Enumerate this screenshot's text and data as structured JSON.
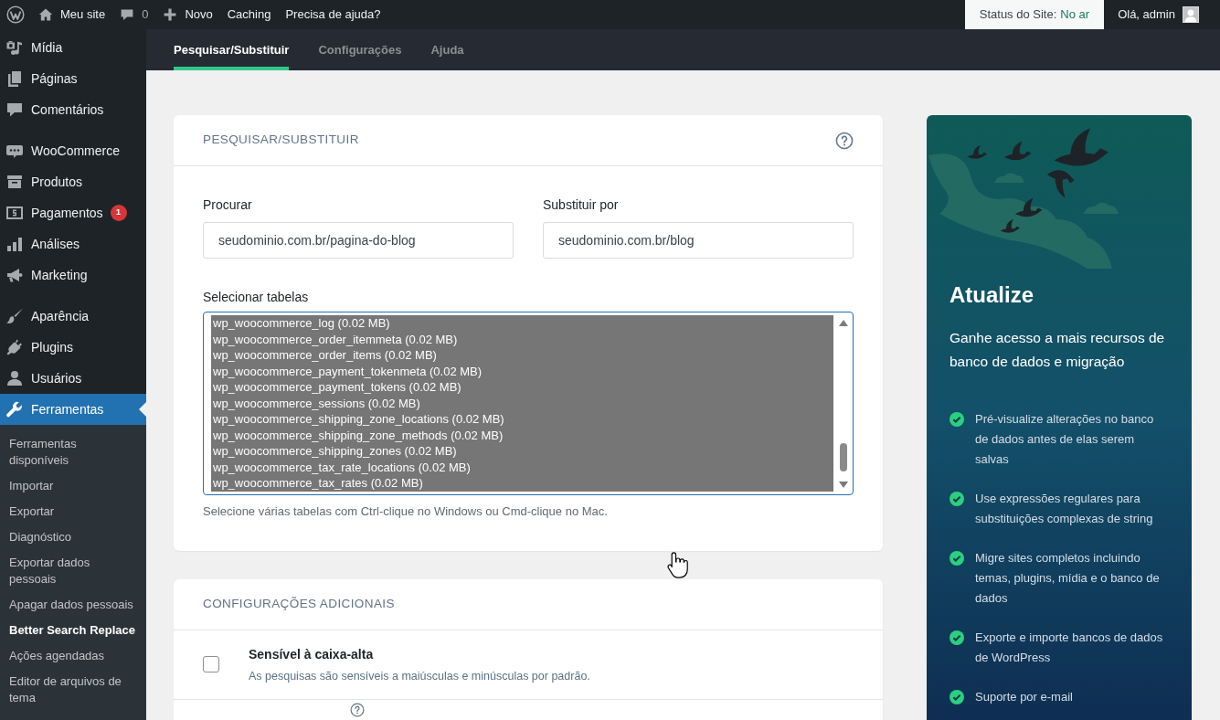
{
  "admin_bar": {
    "items": [
      {
        "kind": "home",
        "label": "Meu site"
      },
      {
        "kind": "comments",
        "label": "0"
      },
      {
        "kind": "new",
        "label": "Novo"
      },
      {
        "kind": "link",
        "label": "Caching"
      },
      {
        "kind": "link",
        "label": "Precisa de ajuda?"
      }
    ],
    "site_status": {
      "label": "Status do Site:",
      "value": "No ar"
    },
    "account": "Olá, admin"
  },
  "sidebar": {
    "groups": [
      {
        "items": [
          {
            "label": "Mídia",
            "selected": false
          },
          {
            "label": "Páginas",
            "selected": false
          },
          {
            "label": "Comentários",
            "selected": false
          }
        ]
      },
      {
        "items": [
          {
            "label": "WooCommerce",
            "selected": false
          },
          {
            "label": "Produtos",
            "selected": false
          },
          {
            "label": "Pagamentos",
            "selected": false,
            "badge": "1"
          },
          {
            "label": "Análises",
            "selected": false
          },
          {
            "label": "Marketing",
            "selected": false
          }
        ]
      },
      {
        "items": [
          {
            "label": "Aparência",
            "selected": false
          },
          {
            "label": "Plugins",
            "selected": false
          },
          {
            "label": "Usuários",
            "selected": false
          },
          {
            "label": "Ferramentas",
            "selected": true,
            "children": [
              {
                "label": "Ferramentas disponíveis",
                "selected": false
              },
              {
                "label": "Importar",
                "selected": false
              },
              {
                "label": "Exportar",
                "selected": false
              },
              {
                "label": "Diagnóstico",
                "selected": false
              },
              {
                "label": "Exportar dados pessoais",
                "selected": false
              },
              {
                "label": "Apagar dados pessoais",
                "selected": false
              },
              {
                "label": "Better Search Replace",
                "selected": true
              },
              {
                "label": "Ações agendadas",
                "selected": false
              },
              {
                "label": "Editor de arquivos de tema",
                "selected": false
              }
            ]
          }
        ]
      }
    ]
  },
  "tabs": [
    {
      "label": "Pesquisar/Substituir",
      "selected": true
    },
    {
      "label": "Configurações",
      "selected": false
    },
    {
      "label": "Ajuda",
      "selected": false
    }
  ],
  "search_card": {
    "title": "PESQUISAR/SUBSTITUIR",
    "fields": [
      {
        "label": "Procurar",
        "value": "seudominio.com.br/pagina-do-blog"
      },
      {
        "label": "Substituir por",
        "value": "seudominio.com.br/blog"
      }
    ],
    "tables": {
      "label": "Selecionar tabelas",
      "items": [
        {
          "text": "wp_woocommerce_log (0.02 MB)",
          "selected": true
        },
        {
          "text": "wp_woocommerce_order_itemmeta (0.02 MB)",
          "selected": true
        },
        {
          "text": "wp_woocommerce_order_items (0.02 MB)",
          "selected": true
        },
        {
          "text": "wp_woocommerce_payment_tokenmeta (0.02 MB)",
          "selected": true
        },
        {
          "text": "wp_woocommerce_payment_tokens (0.02 MB)",
          "selected": true
        },
        {
          "text": "wp_woocommerce_sessions (0.02 MB)",
          "selected": true
        },
        {
          "text": "wp_woocommerce_shipping_zone_locations (0.02 MB)",
          "selected": true
        },
        {
          "text": "wp_woocommerce_shipping_zone_methods (0.02 MB)",
          "selected": true
        },
        {
          "text": "wp_woocommerce_shipping_zones (0.02 MB)",
          "selected": true
        },
        {
          "text": "wp_woocommerce_tax_rate_locations (0.02 MB)",
          "selected": true
        },
        {
          "text": "wp_woocommerce_tax_rates (0.02 MB)",
          "selected": true
        }
      ],
      "hint": "Selecione várias tabelas com Ctrl-clique no Windows ou Cmd-clique no Mac."
    }
  },
  "settings_card": {
    "title": "CONFIGURAÇÕES ADICIONAIS",
    "options": [
      {
        "label": "Sensível à caixa-alta",
        "description": "As pesquisas são sensíveis a maiúsculas e minúsculas por padrão.",
        "checked": false
      }
    ]
  },
  "upgrade_panel": {
    "title": "Atualize",
    "subtitle": "Ganhe acesso a mais recursos de banco de dados e migração",
    "features": [
      "Pré-visualize alterações no banco de dados antes de elas serem salvas",
      "Use expressões regulares para substituições complexas de string",
      "Migre sites completos incluindo temas, plugins, mídia e o banco de dados",
      "Exporte e importe bancos de dados de WordPress",
      "Suporte por e-mail"
    ]
  }
}
